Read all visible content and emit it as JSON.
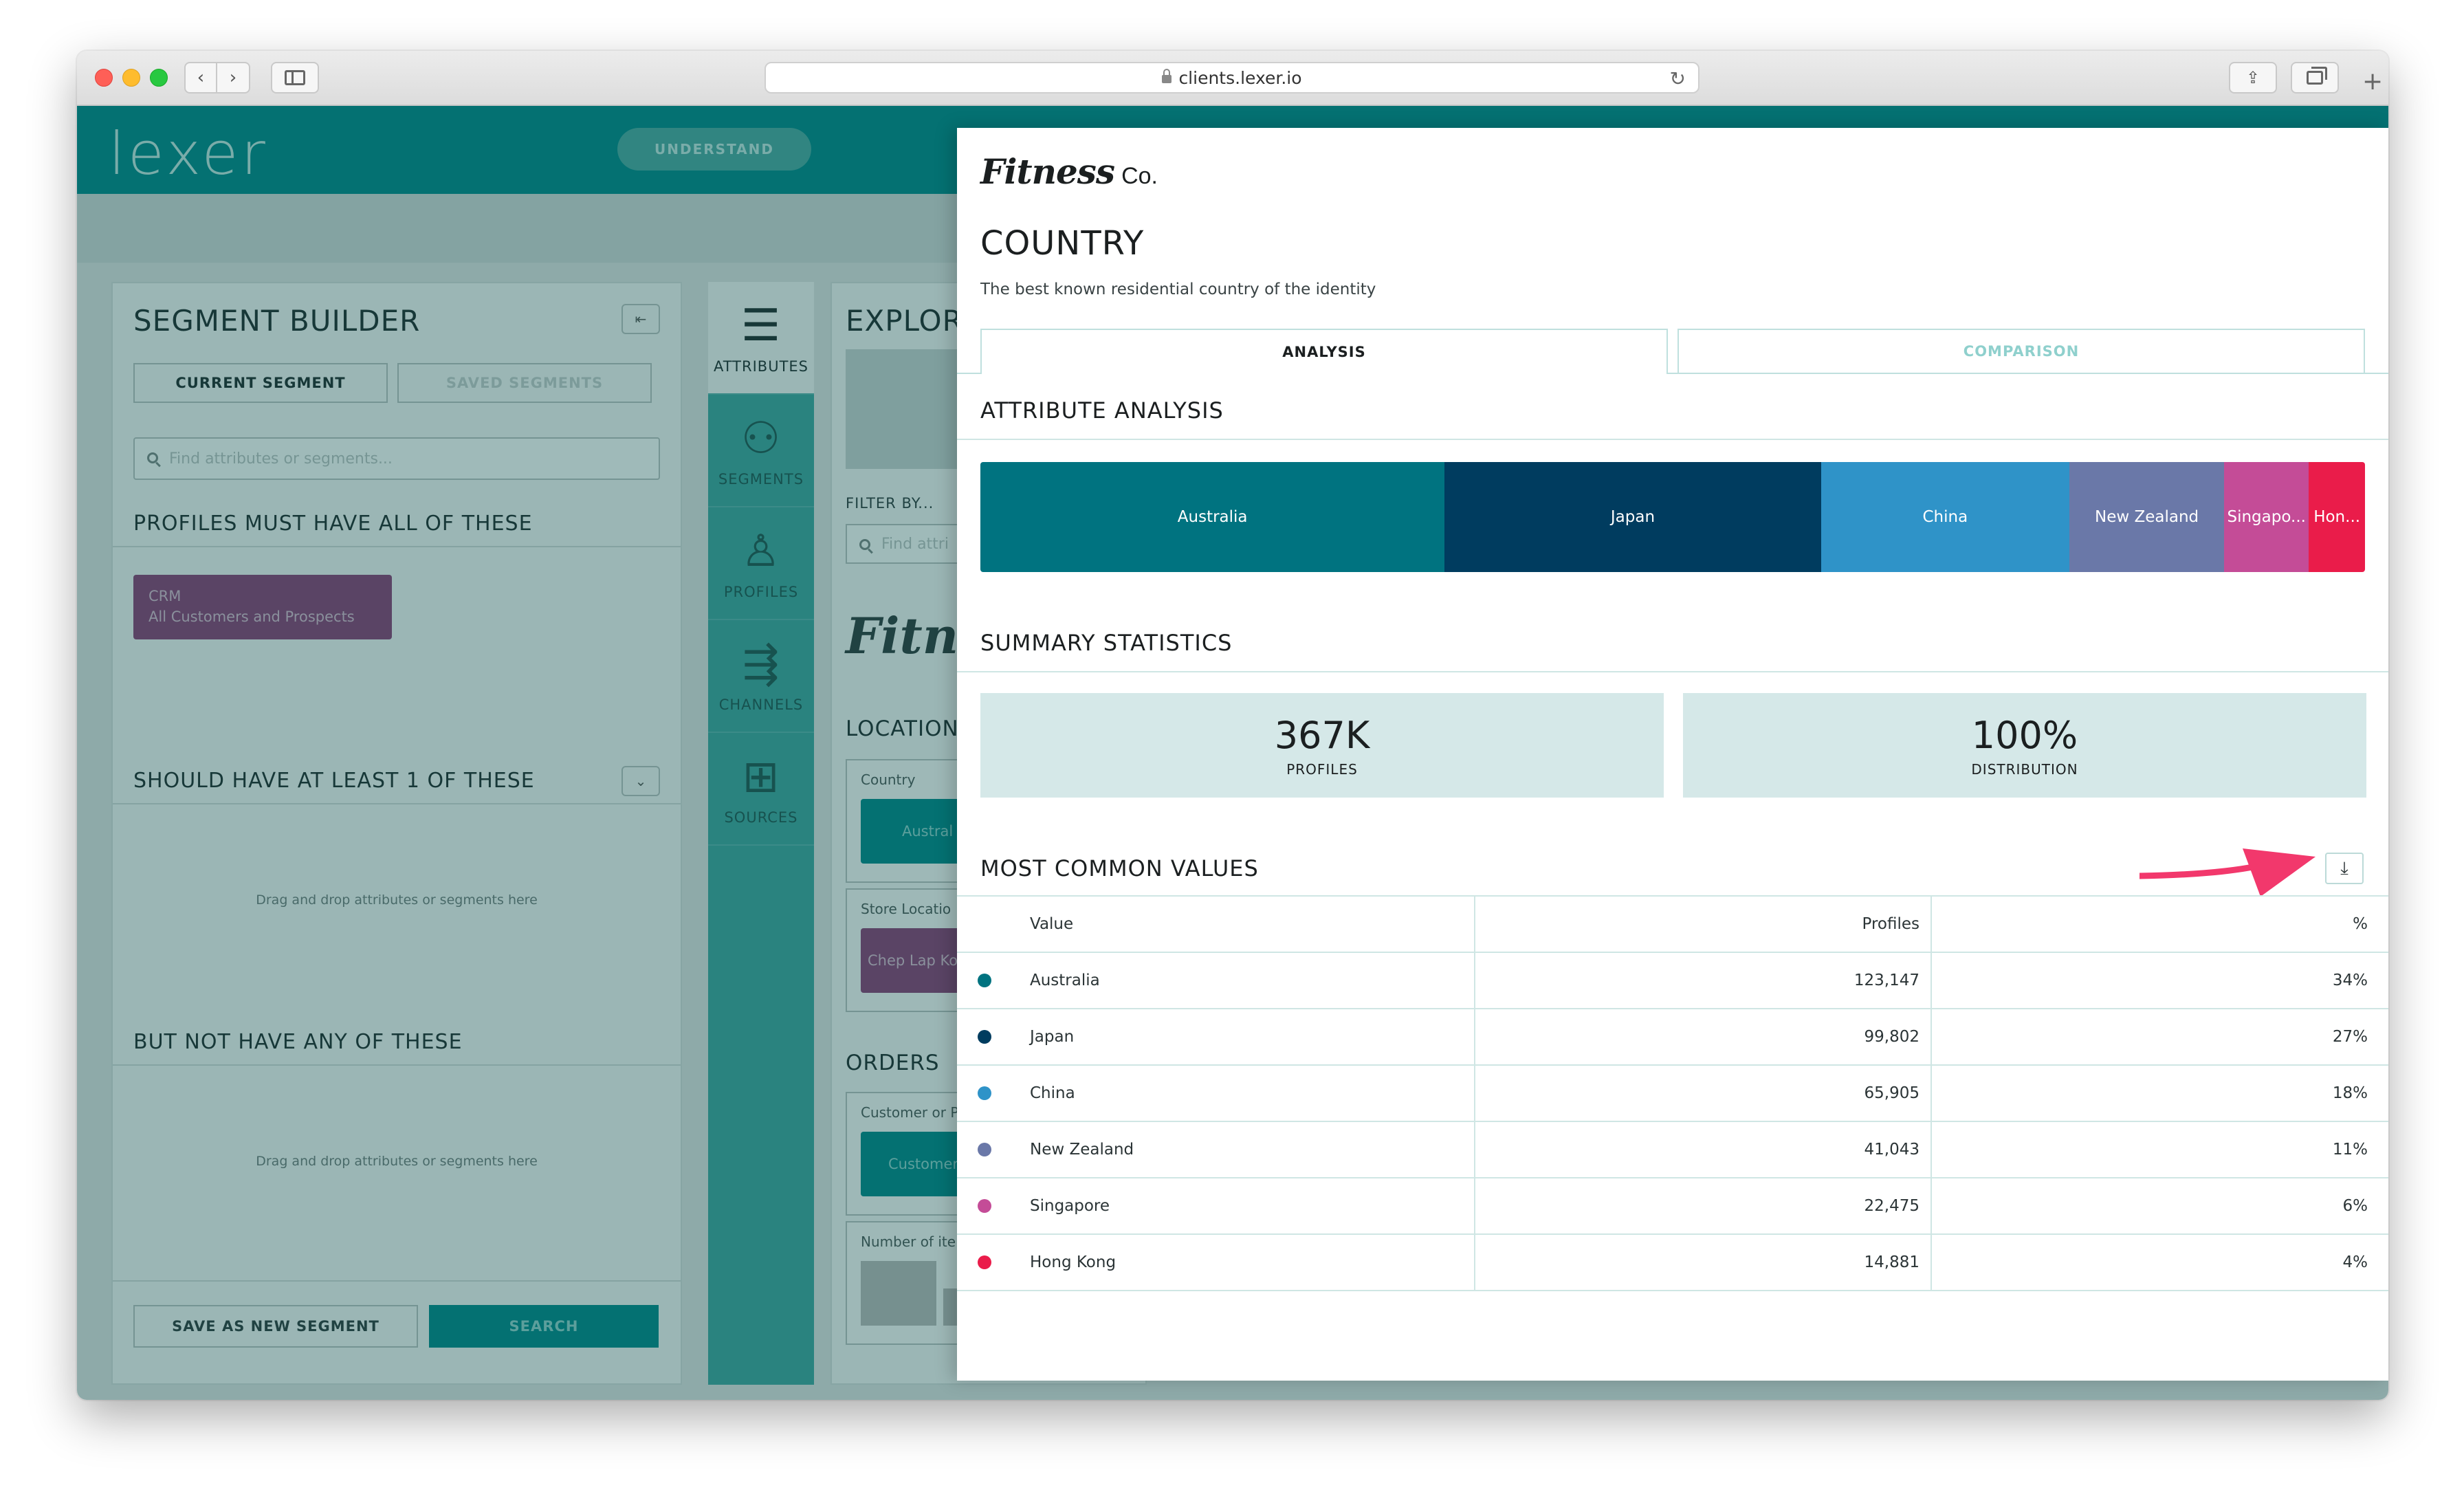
{
  "browser": {
    "url": "clients.lexer.io"
  },
  "app": {
    "logo": "lexer",
    "nav_button": "UNDERSTAND"
  },
  "segment_builder": {
    "title": "SEGMENT BUILDER",
    "tabs": [
      "CURRENT SEGMENT",
      "SAVED SEGMENTS"
    ],
    "search_placeholder": "Find attributes or segments...",
    "must_have": "PROFILES MUST HAVE ALL OF THESE",
    "crm_chip": {
      "line1": "CRM",
      "line2": "All Customers and Prospects"
    },
    "should_have": "SHOULD HAVE AT LEAST 1 OF THESE",
    "drop_hint": "Drag and drop attributes or segments here",
    "not_have": "BUT NOT HAVE ANY OF THESE",
    "save_button": "SAVE AS NEW SEGMENT",
    "search_button": "SEARCH"
  },
  "rail": {
    "items": [
      {
        "label": "ATTRIBUTES",
        "icon": "list-icon"
      },
      {
        "label": "SEGMENTS",
        "icon": "segments-icon"
      },
      {
        "label": "PROFILES",
        "icon": "profile-icon"
      },
      {
        "label": "CHANNELS",
        "icon": "channels-icon"
      },
      {
        "label": "SOURCES",
        "icon": "sources-icon"
      }
    ]
  },
  "explore": {
    "title": "EXPLOR",
    "filter_label": "FILTER BY...",
    "search_placeholder": "Find attri",
    "brand": "Fitnes",
    "location": "LOCATION",
    "country_label": "Country",
    "country_chip": "Austral",
    "store_label": "Store Locatio",
    "store_chip": "Chep Lap Kol",
    "orders": "ORDERS",
    "customer_label": "Customer or P",
    "customer_chip": "Customer",
    "items_label": "Number of ite"
  },
  "panel": {
    "brand_script": "Fitness",
    "brand_suffix": "Co.",
    "title": "COUNTRY",
    "description": "The best known residential country of the identity",
    "tabs": [
      "ANALYSIS",
      "COMPARISON"
    ],
    "attribute_analysis": "ATTRIBUTE ANALYSIS",
    "summary_statistics": "SUMMARY STATISTICS",
    "stats": [
      {
        "value": "367K",
        "label": "PROFILES"
      },
      {
        "value": "100%",
        "label": "DISTRIBUTION"
      }
    ],
    "most_common": "MOST COMMON VALUES",
    "table_headers": {
      "value": "Value",
      "profiles": "Profiles",
      "percent": "%"
    }
  },
  "chart_data": {
    "type": "bar",
    "categories": [
      "Australia",
      "Japan",
      "China",
      "New Zealand",
      "Singapore",
      "Hong Kong"
    ],
    "bar_labels": [
      "Australia",
      "Japan",
      "China",
      "New Zealand",
      "Singapo...",
      "Hon..."
    ],
    "values": [
      123147,
      99802,
      65905,
      41043,
      22475,
      14881
    ],
    "values_display": [
      "123,147",
      "99,802",
      "65,905",
      "41,043",
      "22,475",
      "14,881"
    ],
    "percent_display": [
      "34%",
      "27%",
      "18%",
      "11%",
      "6%",
      "4%"
    ],
    "colors": [
      "#007380",
      "#003c5f",
      "#2f93c8",
      "#6a78a8",
      "#c44c97",
      "#ea1c4a"
    ]
  },
  "colors": {
    "accent": "#00868a",
    "highlight_arrow": "#f2386c"
  }
}
